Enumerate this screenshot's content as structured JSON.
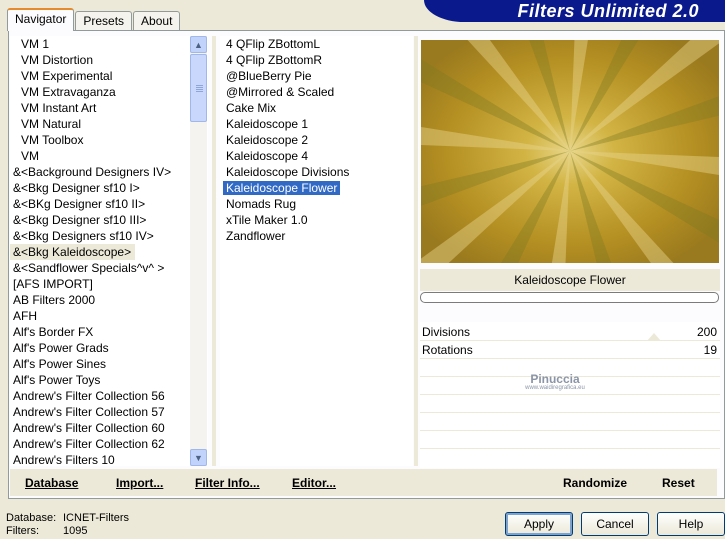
{
  "app_title": "Filters Unlimited 2.0",
  "tabs": [
    {
      "label": "Navigator",
      "active": true
    },
    {
      "label": "Presets",
      "active": false
    },
    {
      "label": "About",
      "active": false
    }
  ],
  "categories": [
    "VM 1",
    "VM Distortion",
    "VM Experimental",
    "VM Extravaganza",
    "VM Instant Art",
    "VM Natural",
    "VM Toolbox",
    "VM",
    "&<Background Designers IV>",
    "&<Bkg Designer sf10 I>",
    "&<BKg Designer sf10 II>",
    "&<Bkg Designer sf10 III>",
    "&<Bkg Designers sf10 IV>",
    "&<Bkg Kaleidoscope>",
    "&<Sandflower Specials^v^ >",
    "[AFS IMPORT]",
    "AB Filters 2000",
    "AFH",
    "Alf's Border FX",
    "Alf's Power Grads",
    "Alf's Power Sines",
    "Alf's Power Toys",
    "Andrew's Filter Collection 56",
    "Andrew's Filter Collection 57",
    "Andrew's Filter Collection 60",
    "Andrew's Filter Collection 62",
    "Andrew's Filters 10"
  ],
  "selected_category": "&<Bkg Kaleidoscope>",
  "filters": [
    "4 QFlip ZBottomL",
    "4 QFlip ZBottomR",
    "@BlueBerry Pie",
    "@Mirrored & Scaled",
    "Cake Mix",
    "Kaleidoscope 1",
    "Kaleidoscope 2",
    "Kaleidoscope 4",
    "Kaleidoscope Divisions",
    "Kaleidoscope Flower",
    "Nomads Rug",
    "xTile Maker 1.0",
    "Zandflower"
  ],
  "selected_filter": "Kaleidoscope Flower",
  "preview_filter_name": "Kaleidoscope Flower",
  "progress": 0,
  "params": [
    {
      "label": "Divisions",
      "value": "200"
    },
    {
      "label": "Rotations",
      "value": "19"
    }
  ],
  "watermark": {
    "title": "Pinuccia",
    "url": "www.waidiregrafica.eu"
  },
  "toolbar": {
    "database": "Database",
    "import": "Import...",
    "filter_info": "Filter Info...",
    "editor": "Editor...",
    "randomize": "Randomize",
    "reset": "Reset"
  },
  "footer": {
    "database_label": "Database:",
    "database_value": "ICNET-Filters",
    "filters_label": "Filters:",
    "filters_value": "1095"
  },
  "buttons": {
    "apply": "Apply",
    "cancel": "Cancel",
    "help": "Help"
  },
  "colors": {
    "selection": "#316ac5",
    "banner": "#0a1a8c",
    "preview_base": "#b89a2b"
  }
}
